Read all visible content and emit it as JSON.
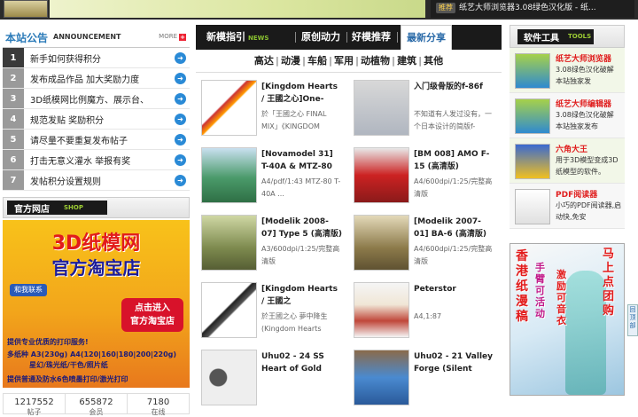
{
  "top": {
    "ticker_badge": "推荐",
    "ticker_text": "纸艺大师浏览器3.08绿色汉化版 - 纸..."
  },
  "announcements": {
    "title": "本站公告",
    "title_en": "ANNOUNCEMENT",
    "more": "MORE",
    "more_icon": "+",
    "items": [
      {
        "num": "1",
        "text": "新手如何获得积分"
      },
      {
        "num": "2",
        "text": "发布成品作品 加大奖励力度"
      },
      {
        "num": "3",
        "text": "3D纸模网比例魔方、展示台、"
      },
      {
        "num": "4",
        "text": "规范发贴 奖励积分"
      },
      {
        "num": "5",
        "text": "请尽量不要重复发布帖子"
      },
      {
        "num": "6",
        "text": "打击无意义灌水 举报有奖"
      },
      {
        "num": "7",
        "text": "发帖积分设置规则"
      }
    ]
  },
  "shop": {
    "title": "官方网店",
    "title_en": "SHOP",
    "ad_line1": "3D纸模网",
    "ad_line2": "官方淘宝店",
    "contact": "和我联系",
    "enter_line1": "点击进入",
    "enter_line2": "官方淘宝店",
    "print_service": "提供专业优质的打印服务!",
    "paper_sizes": "多纸种 A3(230g)  A4(120|160|180|200|220g)",
    "paper_types": "星幻/珠光纸/干色/照片纸",
    "extra": "提供普通及防水6色喷墨打印/激光打印"
  },
  "stats": [
    {
      "value": "1217552",
      "label": "帖子"
    },
    {
      "value": "655872",
      "label": "会员"
    },
    {
      "value": "7180",
      "label": "在线"
    }
  ],
  "tabs": {
    "news": "新模指引",
    "news_en": "NEWS",
    "original": "原创动力",
    "recommend": "好模推荐",
    "latest": "最新分享"
  },
  "subnav": [
    "高达",
    "动漫",
    "车船",
    "军用",
    "动植物",
    "建筑",
    "其他"
  ],
  "subnav_sep": "|",
  "models": [
    {
      "title": "[Kingdom Hearts / 王國之心]One-",
      "desc": "於「王國之心 FINAL MIX」《KINGDOM"
    },
    {
      "title": "入门级骨版的f-86f",
      "desc": "不知道有人发过没有，一个日本设计的简版f-"
    },
    {
      "title": "[Novamodel 31] T-40A & MTZ-80",
      "desc": "A4/pdf/1:43 MTZ-80 T-40A ..."
    },
    {
      "title": "[BM 008] AMO F-15 (高清版)",
      "desc": "A4/600dpi/1:25/完整高清版"
    },
    {
      "title": "[Modelik 2008-07] Type 5 (高清版)",
      "desc": "A3/600dpi/1:25/完整高清版"
    },
    {
      "title": "[Modelik 2007-01] BA-6 (高清版)",
      "desc": "A4/600dpi/1:25/完整高清版"
    },
    {
      "title": "[Kingdom Hearts / 王國之心]Wayward",
      "desc": "於王國之心 夢中降生 (Kingdom Hearts"
    },
    {
      "title": "Peterstor",
      "desc": "A4,1:87"
    },
    {
      "title": "Uhu02 - 24 SS Heart of Gold",
      "desc": ""
    },
    {
      "title": "Uhu02 - 21 Valley Forge (Silent",
      "desc": ""
    }
  ],
  "tools": {
    "title": "软件工具",
    "title_en": "TOOLS",
    "items": [
      {
        "name": "纸艺大师浏览器",
        "desc": "3.08绿色汉化破解 本站独家发"
      },
      {
        "name": "纸艺大师编辑器",
        "desc": "3.08绿色汉化破解 本站独家发布"
      },
      {
        "name": "六角大王",
        "desc": "用于3D模型变成3D纸模型的软件。"
      },
      {
        "name": "PDF阅读器",
        "desc": "小巧的PDF阅读器,启动快,免安"
      }
    ]
  },
  "right_ad": {
    "v1": "香港纸漫稿",
    "v2": "手臂可活动",
    "v3": "激励可音衣",
    "v4": "马上点团购"
  },
  "float_btn": "回顶部"
}
